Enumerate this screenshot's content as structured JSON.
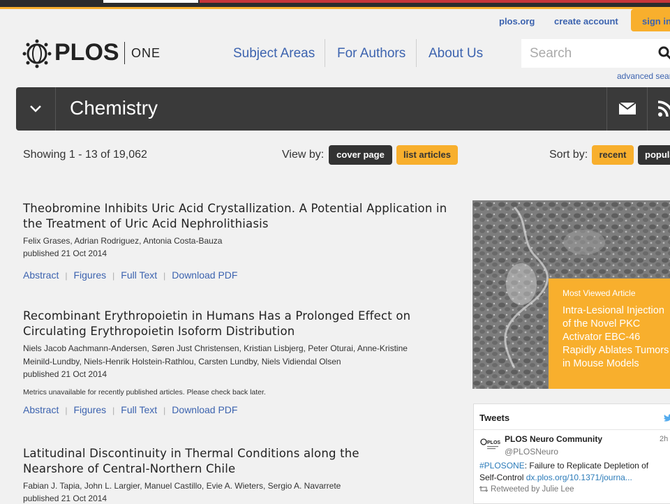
{
  "utility_links": {
    "plos_org": "plos.org",
    "create_account": "create account",
    "sign_in": "sign in"
  },
  "logo": {
    "brand": "PLOS",
    "journal": "ONE"
  },
  "nav": {
    "items": [
      "Subject Areas",
      "For Authors",
      "About Us"
    ]
  },
  "search": {
    "placeholder": "Search",
    "advanced": "advanced search"
  },
  "category": {
    "title": "Chemistry"
  },
  "listing": {
    "showing": "Showing 1 - 13 of 19,062",
    "view_by_label": "View by:",
    "view_cover": "cover page",
    "view_list": "list articles",
    "sort_by_label": "Sort by:",
    "sort_recent": "recent",
    "sort_popular": "popular"
  },
  "articles": [
    {
      "title": "Theobromine Inhibits Uric Acid Crystallization. A Potential Application in the Treatment of Uric Acid Nephrolithiasis",
      "authors": "Felix Grases, Adrian Rodriguez, Antonia Costa-Bauza",
      "published": "published 21 Oct 2014",
      "metrics": "",
      "links": [
        "Abstract",
        "Figures",
        "Full Text",
        "Download PDF"
      ]
    },
    {
      "title": "Recombinant Erythropoietin in Humans Has a Prolonged Effect on Circulating Erythropoietin Isoform Distribution",
      "authors": "Niels Jacob Aachmann-Andersen, Søren Just Christensen, Kristian Lisbjerg, Peter Oturai, Anne-Kristine Meinild-Lundby, Niels-Henrik Holstein-Rathlou, Carsten Lundby, Niels Vidiendal Olsen",
      "published": "published 21 Oct 2014",
      "metrics": "Metrics unavailable for recently published articles. Please check back later.",
      "links": [
        "Abstract",
        "Figures",
        "Full Text",
        "Download PDF"
      ]
    },
    {
      "title": "Latitudinal Discontinuity in Thermal Conditions along the Nearshore of Central-Northern Chile",
      "authors": "Fabian J. Tapia, John L. Largier, Manuel Castillo, Evie A. Wieters, Sergio A. Navarrete",
      "published": "published 21 Oct 2014",
      "metrics": "",
      "links": []
    }
  ],
  "feature": {
    "label": "Most Viewed Article",
    "title": "Intra-Lesional Injection of the Novel PKC Activator EBC-46 Rapidly Ablates Tumors in Mouse Models"
  },
  "tweets": {
    "header": "Tweets",
    "name": "PLOS Neuro Community",
    "handle": "@PLOSNeuro",
    "time": "2h",
    "tag": "#PLOSONE",
    "text": ": Failure to Replicate Depletion of Self-Control ",
    "url": "dx.plos.org/10.1371/journa...",
    "retweet": "Retweeted by Julie Lee"
  },
  "colors": {
    "accent": "#f8af2d",
    "link": "#3c63af",
    "dark": "#3a3a3a"
  }
}
